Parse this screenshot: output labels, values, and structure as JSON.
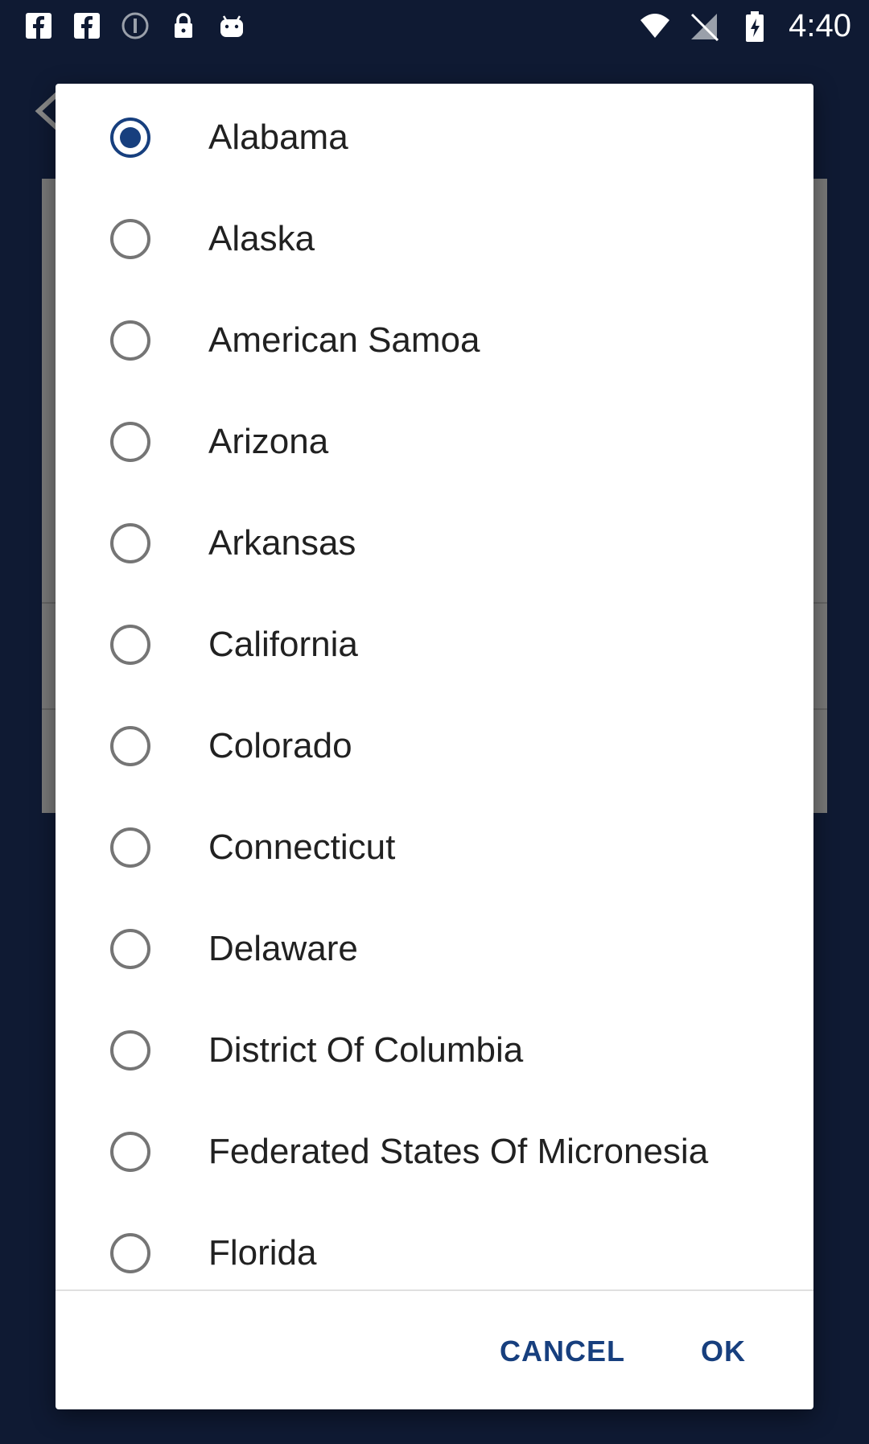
{
  "status_bar": {
    "time": "4:40",
    "left_icons": [
      "facebook-icon",
      "facebook-icon",
      "info-icon",
      "lock-icon",
      "android-icon"
    ],
    "right_icons": [
      "wifi-icon",
      "signal-icon",
      "battery-icon"
    ]
  },
  "colors": {
    "accent": "#173f7e",
    "background": "#0f1a33",
    "dialog": "#ffffff"
  },
  "dialog": {
    "selected": "Alabama",
    "options": [
      {
        "label": "Alabama",
        "checked": true
      },
      {
        "label": "Alaska",
        "checked": false
      },
      {
        "label": "American Samoa",
        "checked": false
      },
      {
        "label": "Arizona",
        "checked": false
      },
      {
        "label": "Arkansas",
        "checked": false
      },
      {
        "label": "California",
        "checked": false
      },
      {
        "label": "Colorado",
        "checked": false
      },
      {
        "label": "Connecticut",
        "checked": false
      },
      {
        "label": "Delaware",
        "checked": false
      },
      {
        "label": "District Of Columbia",
        "checked": false
      },
      {
        "label": "Federated States Of Micronesia",
        "checked": false
      },
      {
        "label": "Florida",
        "checked": false
      }
    ],
    "cancel_label": "CANCEL",
    "ok_label": "OK"
  }
}
